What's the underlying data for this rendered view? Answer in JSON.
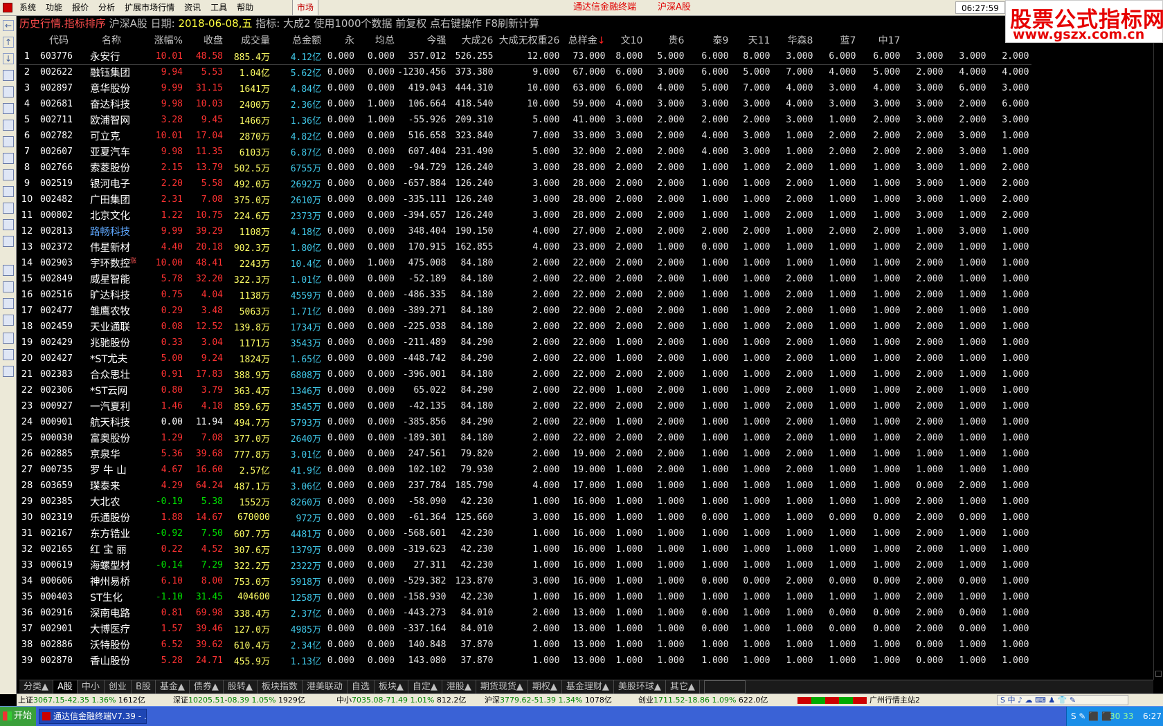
{
  "menu": {
    "items": [
      "系统",
      "功能",
      "报价",
      "分析",
      "扩展市场行情",
      "资讯",
      "工具",
      "帮助"
    ],
    "market_btn": "市场",
    "title": "通达信金融终端",
    "market": "沪深A股",
    "clock": "06:27:59"
  },
  "logo": {
    "cn": "股票公式指标网",
    "url": "www.gszx.com.cn"
  },
  "infobar": {
    "title": "历史行情.指标排序",
    "market": "沪深A股",
    "date_label": "日期:",
    "date": "2018-06-08,五",
    "indicator": "指标: 大成2",
    "note": "使用1000个数据 前复权 点右键操作 F8刷新计算"
  },
  "columns": [
    "",
    "代码",
    "名称",
    "涨幅%",
    "收盘",
    "成交量",
    "总金额",
    "永",
    "均总",
    "今强",
    "大成26",
    "大成无权重26",
    "总样金",
    "文10",
    "贵6",
    "泰9",
    "天11",
    "华森8",
    "蓝7",
    "中17",
    "",
    "",
    "",
    ""
  ],
  "sort_arrow": "↓",
  "rows": [
    [
      "1",
      "603776",
      "永安行",
      "10.01",
      "48.58",
      "885.4万",
      "4.12亿",
      "0.000",
      "0.000",
      "357.012",
      "526.255",
      "12.000",
      "73.000",
      "8.000",
      "5.000",
      "6.000",
      "8.000",
      "3.000",
      "6.000",
      "6.000",
      "3.000",
      "3.000",
      "2.000"
    ],
    [
      "2",
      "002622",
      "融钰集团",
      "9.94",
      "5.53",
      "1.04亿",
      "5.62亿",
      "0.000",
      "0.000",
      "-1230.456",
      "373.380",
      "9.000",
      "67.000",
      "6.000",
      "3.000",
      "6.000",
      "5.000",
      "7.000",
      "4.000",
      "5.000",
      "2.000",
      "4.000",
      "4.000"
    ],
    [
      "3",
      "002897",
      "意华股份",
      "9.99",
      "31.15",
      "1641万",
      "4.84亿",
      "0.000",
      "0.000",
      "419.043",
      "444.310",
      "10.000",
      "63.000",
      "6.000",
      "4.000",
      "5.000",
      "7.000",
      "4.000",
      "3.000",
      "4.000",
      "3.000",
      "6.000",
      "3.000"
    ],
    [
      "4",
      "002681",
      "奋达科技",
      "9.98",
      "10.03",
      "2400万",
      "2.36亿",
      "0.000",
      "1.000",
      "106.664",
      "418.540",
      "10.000",
      "59.000",
      "4.000",
      "3.000",
      "3.000",
      "3.000",
      "4.000",
      "3.000",
      "3.000",
      "3.000",
      "2.000",
      "6.000"
    ],
    [
      "5",
      "002711",
      "欧浦智网",
      "3.28",
      "9.45",
      "1466万",
      "1.36亿",
      "0.000",
      "1.000",
      "-55.926",
      "209.310",
      "5.000",
      "41.000",
      "3.000",
      "2.000",
      "2.000",
      "2.000",
      "3.000",
      "1.000",
      "2.000",
      "3.000",
      "2.000",
      "3.000"
    ],
    [
      "6",
      "002782",
      "可立克",
      "10.01",
      "17.04",
      "2870万",
      "4.82亿",
      "0.000",
      "0.000",
      "516.658",
      "323.840",
      "7.000",
      "33.000",
      "3.000",
      "2.000",
      "4.000",
      "3.000",
      "1.000",
      "2.000",
      "2.000",
      "2.000",
      "3.000",
      "1.000"
    ],
    [
      "7",
      "002607",
      "亚夏汽车",
      "9.98",
      "11.35",
      "6103万",
      "6.87亿",
      "0.000",
      "0.000",
      "607.404",
      "231.490",
      "5.000",
      "32.000",
      "2.000",
      "2.000",
      "4.000",
      "3.000",
      "1.000",
      "2.000",
      "2.000",
      "2.000",
      "3.000",
      "1.000"
    ],
    [
      "8",
      "002766",
      "索菱股份",
      "2.15",
      "13.79",
      "502.5万",
      "6755万",
      "0.000",
      "0.000",
      "-94.729",
      "126.240",
      "3.000",
      "28.000",
      "2.000",
      "2.000",
      "1.000",
      "1.000",
      "2.000",
      "1.000",
      "1.000",
      "3.000",
      "1.000",
      "2.000"
    ],
    [
      "9",
      "002519",
      "银河电子",
      "2.20",
      "5.58",
      "492.0万",
      "2692万",
      "0.000",
      "0.000",
      "-657.884",
      "126.240",
      "3.000",
      "28.000",
      "2.000",
      "2.000",
      "1.000",
      "1.000",
      "2.000",
      "1.000",
      "1.000",
      "3.000",
      "1.000",
      "2.000"
    ],
    [
      "10",
      "002482",
      "广田集团",
      "2.31",
      "7.08",
      "375.0万",
      "2610万",
      "0.000",
      "0.000",
      "-335.111",
      "126.240",
      "3.000",
      "28.000",
      "2.000",
      "2.000",
      "1.000",
      "1.000",
      "2.000",
      "1.000",
      "1.000",
      "3.000",
      "1.000",
      "2.000"
    ],
    [
      "11",
      "000802",
      "北京文化",
      "1.22",
      "10.75",
      "224.6万",
      "2373万",
      "0.000",
      "0.000",
      "-394.657",
      "126.240",
      "3.000",
      "28.000",
      "2.000",
      "2.000",
      "1.000",
      "1.000",
      "2.000",
      "1.000",
      "1.000",
      "3.000",
      "1.000",
      "2.000"
    ],
    [
      "12",
      "002813",
      "路畅科技",
      "9.99",
      "39.29",
      "1108万",
      "4.18亿",
      "0.000",
      "0.000",
      "348.404",
      "190.150",
      "4.000",
      "27.000",
      "2.000",
      "2.000",
      "2.000",
      "2.000",
      "1.000",
      "2.000",
      "2.000",
      "1.000",
      "3.000",
      "1.000"
    ],
    [
      "13",
      "002372",
      "伟星新材",
      "4.40",
      "20.18",
      "902.3万",
      "1.80亿",
      "0.000",
      "0.000",
      "170.915",
      "162.855",
      "4.000",
      "23.000",
      "2.000",
      "1.000",
      "0.000",
      "1.000",
      "1.000",
      "1.000",
      "1.000",
      "2.000",
      "1.000",
      "1.000"
    ],
    [
      "14",
      "002903",
      "宇环数控",
      "10.00",
      "48.41",
      "2243万",
      "10.4亿",
      "0.000",
      "1.000",
      "475.008",
      "84.180",
      "2.000",
      "22.000",
      "2.000",
      "2.000",
      "1.000",
      "1.000",
      "1.000",
      "1.000",
      "1.000",
      "2.000",
      "1.000",
      "1.000"
    ],
    [
      "15",
      "002849",
      "威星智能",
      "5.78",
      "32.20",
      "322.3万",
      "1.01亿",
      "0.000",
      "0.000",
      "-52.189",
      "84.180",
      "2.000",
      "22.000",
      "2.000",
      "2.000",
      "1.000",
      "1.000",
      "2.000",
      "1.000",
      "1.000",
      "2.000",
      "1.000",
      "1.000"
    ],
    [
      "16",
      "002516",
      "旷达科技",
      "0.75",
      "4.04",
      "1138万",
      "4559万",
      "0.000",
      "0.000",
      "-486.335",
      "84.180",
      "2.000",
      "22.000",
      "2.000",
      "2.000",
      "1.000",
      "1.000",
      "2.000",
      "1.000",
      "1.000",
      "2.000",
      "1.000",
      "1.000"
    ],
    [
      "17",
      "002477",
      "雏鹰农牧",
      "0.29",
      "3.48",
      "5063万",
      "1.71亿",
      "0.000",
      "0.000",
      "-389.271",
      "84.180",
      "2.000",
      "22.000",
      "2.000",
      "2.000",
      "1.000",
      "1.000",
      "2.000",
      "1.000",
      "1.000",
      "2.000",
      "1.000",
      "1.000"
    ],
    [
      "18",
      "002459",
      "天业通联",
      "0.08",
      "12.52",
      "139.8万",
      "1734万",
      "0.000",
      "0.000",
      "-225.038",
      "84.180",
      "2.000",
      "22.000",
      "2.000",
      "2.000",
      "1.000",
      "1.000",
      "2.000",
      "1.000",
      "1.000",
      "2.000",
      "1.000",
      "1.000"
    ],
    [
      "19",
      "002429",
      "兆驰股份",
      "0.33",
      "3.04",
      "1171万",
      "3543万",
      "0.000",
      "0.000",
      "-211.489",
      "84.290",
      "2.000",
      "22.000",
      "1.000",
      "2.000",
      "1.000",
      "1.000",
      "2.000",
      "1.000",
      "1.000",
      "2.000",
      "1.000",
      "1.000"
    ],
    [
      "20",
      "002427",
      "*ST尤夫",
      "5.00",
      "9.24",
      "1824万",
      "1.65亿",
      "0.000",
      "0.000",
      "-448.742",
      "84.290",
      "2.000",
      "22.000",
      "1.000",
      "2.000",
      "1.000",
      "1.000",
      "2.000",
      "1.000",
      "1.000",
      "2.000",
      "1.000",
      "1.000"
    ],
    [
      "21",
      "002383",
      "合众思壮",
      "0.91",
      "17.83",
      "388.9万",
      "6808万",
      "0.000",
      "0.000",
      "-396.001",
      "84.180",
      "2.000",
      "22.000",
      "2.000",
      "2.000",
      "1.000",
      "1.000",
      "2.000",
      "1.000",
      "1.000",
      "2.000",
      "1.000",
      "1.000"
    ],
    [
      "22",
      "002306",
      "*ST云网",
      "0.80",
      "3.79",
      "363.4万",
      "1346万",
      "0.000",
      "0.000",
      "65.022",
      "84.290",
      "2.000",
      "22.000",
      "1.000",
      "2.000",
      "1.000",
      "1.000",
      "2.000",
      "1.000",
      "1.000",
      "2.000",
      "1.000",
      "1.000"
    ],
    [
      "23",
      "000927",
      "一汽夏利",
      "1.46",
      "4.18",
      "859.6万",
      "3545万",
      "0.000",
      "0.000",
      "-42.135",
      "84.180",
      "2.000",
      "22.000",
      "2.000",
      "2.000",
      "1.000",
      "1.000",
      "2.000",
      "1.000",
      "1.000",
      "2.000",
      "1.000",
      "1.000"
    ],
    [
      "24",
      "000901",
      "航天科技",
      "0.00",
      "11.94",
      "494.7万",
      "5793万",
      "0.000",
      "0.000",
      "-385.856",
      "84.290",
      "2.000",
      "22.000",
      "1.000",
      "2.000",
      "1.000",
      "1.000",
      "2.000",
      "1.000",
      "1.000",
      "2.000",
      "1.000",
      "1.000"
    ],
    [
      "25",
      "000030",
      "富奥股份",
      "1.29",
      "7.08",
      "377.0万",
      "2640万",
      "0.000",
      "0.000",
      "-189.301",
      "84.180",
      "2.000",
      "22.000",
      "2.000",
      "2.000",
      "1.000",
      "1.000",
      "2.000",
      "1.000",
      "1.000",
      "2.000",
      "1.000",
      "1.000"
    ],
    [
      "26",
      "002885",
      "京泉华",
      "5.36",
      "39.68",
      "777.8万",
      "3.01亿",
      "0.000",
      "0.000",
      "247.561",
      "79.820",
      "2.000",
      "19.000",
      "2.000",
      "2.000",
      "1.000",
      "1.000",
      "2.000",
      "1.000",
      "1.000",
      "1.000",
      "1.000",
      "1.000"
    ],
    [
      "27",
      "000735",
      "罗 牛 山",
      "4.67",
      "16.60",
      "2.57亿",
      "41.9亿",
      "0.000",
      "0.000",
      "102.102",
      "79.930",
      "2.000",
      "19.000",
      "1.000",
      "2.000",
      "1.000",
      "1.000",
      "2.000",
      "1.000",
      "1.000",
      "1.000",
      "1.000",
      "1.000"
    ],
    [
      "28",
      "603659",
      "璞泰来",
      "4.29",
      "64.24",
      "487.1万",
      "3.06亿",
      "0.000",
      "0.000",
      "237.784",
      "185.790",
      "4.000",
      "17.000",
      "1.000",
      "1.000",
      "1.000",
      "1.000",
      "1.000",
      "1.000",
      "1.000",
      "0.000",
      "2.000",
      "1.000"
    ],
    [
      "29",
      "002385",
      "大北农",
      "-0.19",
      "5.38",
      "1552万",
      "8260万",
      "0.000",
      "0.000",
      "-58.090",
      "42.230",
      "1.000",
      "16.000",
      "1.000",
      "1.000",
      "1.000",
      "1.000",
      "1.000",
      "1.000",
      "1.000",
      "2.000",
      "1.000",
      "1.000"
    ],
    [
      "30",
      "002319",
      "乐通股份",
      "1.88",
      "14.67",
      "670000",
      "972万",
      "0.000",
      "0.000",
      "-61.364",
      "125.660",
      "3.000",
      "16.000",
      "1.000",
      "1.000",
      "0.000",
      "1.000",
      "1.000",
      "0.000",
      "0.000",
      "2.000",
      "0.000",
      "1.000"
    ],
    [
      "31",
      "002167",
      "东方锆业",
      "-0.92",
      "7.50",
      "607.7万",
      "4481万",
      "0.000",
      "0.000",
      "-568.601",
      "42.230",
      "1.000",
      "16.000",
      "1.000",
      "1.000",
      "1.000",
      "1.000",
      "1.000",
      "1.000",
      "1.000",
      "2.000",
      "1.000",
      "1.000"
    ],
    [
      "32",
      "002165",
      "红 宝 丽",
      "0.22",
      "4.52",
      "307.6万",
      "1379万",
      "0.000",
      "0.000",
      "-319.623",
      "42.230",
      "1.000",
      "16.000",
      "1.000",
      "1.000",
      "1.000",
      "1.000",
      "1.000",
      "1.000",
      "1.000",
      "2.000",
      "1.000",
      "1.000"
    ],
    [
      "33",
      "000619",
      "海螺型材",
      "-0.14",
      "7.29",
      "322.2万",
      "2322万",
      "0.000",
      "0.000",
      "27.311",
      "42.230",
      "1.000",
      "16.000",
      "1.000",
      "1.000",
      "1.000",
      "1.000",
      "1.000",
      "1.000",
      "1.000",
      "2.000",
      "1.000",
      "1.000"
    ],
    [
      "34",
      "000606",
      "神州易桥",
      "6.10",
      "8.00",
      "753.0万",
      "5918万",
      "0.000",
      "0.000",
      "-529.382",
      "123.870",
      "3.000",
      "16.000",
      "1.000",
      "1.000",
      "0.000",
      "0.000",
      "2.000",
      "0.000",
      "0.000",
      "2.000",
      "0.000",
      "1.000"
    ],
    [
      "35",
      "000403",
      "ST生化",
      "-1.10",
      "31.45",
      "404600",
      "1258万",
      "0.000",
      "0.000",
      "-158.930",
      "42.230",
      "1.000",
      "16.000",
      "1.000",
      "1.000",
      "1.000",
      "1.000",
      "1.000",
      "1.000",
      "1.000",
      "2.000",
      "1.000",
      "1.000"
    ],
    [
      "36",
      "002916",
      "深南电路",
      "0.81",
      "69.98",
      "338.4万",
      "2.37亿",
      "0.000",
      "0.000",
      "-443.273",
      "84.010",
      "2.000",
      "13.000",
      "1.000",
      "1.000",
      "0.000",
      "1.000",
      "1.000",
      "0.000",
      "0.000",
      "2.000",
      "0.000",
      "1.000"
    ],
    [
      "37",
      "002901",
      "大博医疗",
      "1.57",
      "39.46",
      "127.0万",
      "4985万",
      "0.000",
      "0.000",
      "-337.164",
      "84.010",
      "2.000",
      "13.000",
      "1.000",
      "1.000",
      "0.000",
      "1.000",
      "1.000",
      "0.000",
      "0.000",
      "2.000",
      "0.000",
      "1.000"
    ],
    [
      "38",
      "002886",
      "沃特股份",
      "6.52",
      "39.62",
      "610.4万",
      "2.34亿",
      "0.000",
      "0.000",
      "140.848",
      "37.870",
      "1.000",
      "13.000",
      "1.000",
      "1.000",
      "1.000",
      "1.000",
      "1.000",
      "1.000",
      "1.000",
      "0.000",
      "1.000",
      "1.000"
    ],
    [
      "39",
      "002870",
      "香山股份",
      "5.28",
      "24.71",
      "455.9万",
      "1.13亿",
      "0.000",
      "0.000",
      "143.080",
      "37.870",
      "1.000",
      "13.000",
      "1.000",
      "1.000",
      "1.000",
      "1.000",
      "1.000",
      "1.000",
      "1.000",
      "0.000",
      "1.000",
      "1.000"
    ]
  ],
  "highlight_names": [
    "路畅科技"
  ],
  "name_badge": {
    "row": "14",
    "text": "涨"
  },
  "tabs": [
    "分类▲",
    "A股",
    "中小",
    "创业",
    "B股",
    "基金▲",
    "债券▲",
    "股转▲",
    "板块指数",
    "港美联动",
    "自选",
    "板块▲",
    "自定▲",
    "港股▲",
    "期货现货▲",
    "期权▲",
    "基金理财▲",
    "美股环球▲",
    "其它▲"
  ],
  "active_tab": "A股",
  "indexbar": {
    "sh": {
      "name": "上证",
      "val": "3067.15-42.35",
      "pct": "1.36%",
      "amt": "1612亿"
    },
    "sz": {
      "name": "深证",
      "val": "10205.51",
      "chg": "08.39",
      "pct": "1.05%",
      "amt": "1929亿"
    },
    "zx": {
      "name": "中小",
      "val": "7035.08-71.49",
      "pct": "1.01%",
      "amt": "812.2亿"
    },
    "hs": {
      "name": "沪深",
      "val": "3779.62-51.39",
      "pct": "1.34%",
      "amt": "1078亿"
    },
    "cy": {
      "name": "创业",
      "val": "1711.52-18.86",
      "pct": "1.09%",
      "amt": "622.0亿"
    },
    "station": "广州行情主站2",
    "ime": "S 中 ♪ ☁ ⌨ ♟ 👕 ✎"
  },
  "taskbar": {
    "start": "开始",
    "task": "通达信金融终端V7.39 - ...",
    "tray_nums": "30 33",
    "time": "6:27"
  }
}
